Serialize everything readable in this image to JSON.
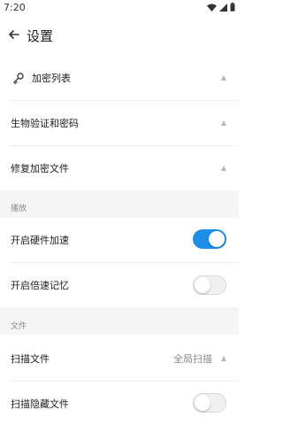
{
  "status": {
    "time": "7:20"
  },
  "header": {
    "title": "设置"
  },
  "items_top": [
    {
      "label": "加密列表",
      "icon": "key-icon"
    },
    {
      "label": "生物验证和密码"
    },
    {
      "label": "修复加密文件"
    }
  ],
  "playback": {
    "section_label": "播放",
    "items": [
      {
        "label": "开启硬件加速",
        "toggle": "on"
      },
      {
        "label": "开启倍速记忆",
        "toggle": "off"
      }
    ]
  },
  "files": {
    "section_label": "文件",
    "items": [
      {
        "label": "扫描文件",
        "value": "全局扫描"
      },
      {
        "label": "扫描隐藏文件",
        "toggle": "off"
      }
    ]
  },
  "colors": {
    "accent": "#1e8ee8"
  }
}
